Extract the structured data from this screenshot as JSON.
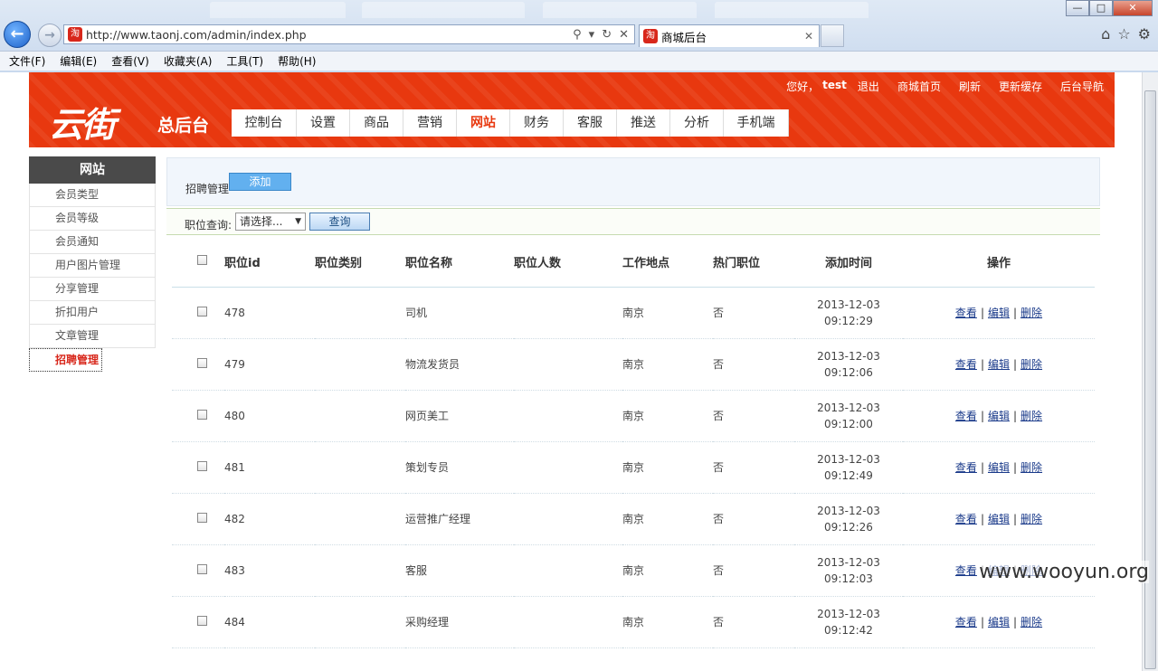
{
  "browser": {
    "url": "http://www.taonj.com/admin/index.php",
    "tab_title": "商城后台",
    "favicon_text": "淘",
    "menu": [
      "文件(F)",
      "编辑(E)",
      "查看(V)",
      "收藏夹(A)",
      "工具(T)",
      "帮助(H)"
    ],
    "window": {
      "min": "—",
      "max": "□",
      "close": "✕"
    }
  },
  "header": {
    "logo": "云街",
    "logo_sub": "总后台",
    "greeting": "您好，",
    "username": "test",
    "logout": "退出",
    "links": [
      "商城首页",
      "刷新",
      "更新缓存",
      "后台导航"
    ],
    "nav": [
      "控制台",
      "设置",
      "商品",
      "营销",
      "网站",
      "财务",
      "客服",
      "推送",
      "分析",
      "手机端"
    ],
    "active_nav": "网站",
    "accent_color": "#e8380f"
  },
  "sidebar": {
    "title": "网站",
    "items": [
      "会员类型",
      "会员等级",
      "会员通知",
      "用户图片管理",
      "分享管理",
      "折扣用户",
      "文章管理",
      "招聘管理"
    ],
    "active": "招聘管理"
  },
  "main": {
    "section_label": "招聘管理",
    "add_button": "添加",
    "filter_label": "职位查询:",
    "filter_select": "请选择...",
    "query_button": "查询",
    "columns": [
      "职位id",
      "职位类别",
      "职位名称",
      "职位人数",
      "工作地点",
      "热门职位",
      "添加时间",
      "操作"
    ],
    "rows": [
      {
        "id": "478",
        "category": "",
        "name": "司机",
        "count": "",
        "location": "南京",
        "hot": "否",
        "date": "2013-12-03",
        "time": "09:12:29"
      },
      {
        "id": "479",
        "category": "",
        "name": "物流发货员",
        "count": "",
        "location": "南京",
        "hot": "否",
        "date": "2013-12-03",
        "time": "09:12:06"
      },
      {
        "id": "480",
        "category": "",
        "name": "网页美工",
        "count": "",
        "location": "南京",
        "hot": "否",
        "date": "2013-12-03",
        "time": "09:12:00"
      },
      {
        "id": "481",
        "category": "",
        "name": "策划专员",
        "count": "",
        "location": "南京",
        "hot": "否",
        "date": "2013-12-03",
        "time": "09:12:49"
      },
      {
        "id": "482",
        "category": "",
        "name": "运营推广经理",
        "count": "",
        "location": "南京",
        "hot": "否",
        "date": "2013-12-03",
        "time": "09:12:26"
      },
      {
        "id": "483",
        "category": "",
        "name": "客服",
        "count": "",
        "location": "南京",
        "hot": "否",
        "date": "2013-12-03",
        "time": "09:12:03"
      },
      {
        "id": "484",
        "category": "",
        "name": "采购经理",
        "count": "",
        "location": "南京",
        "hot": "否",
        "date": "2013-12-03",
        "time": "09:12:42"
      }
    ],
    "ops": {
      "view": "查看",
      "edit": "编辑",
      "delete": "删除",
      "sep": "|"
    }
  },
  "watermark": "www.wooyun.org"
}
